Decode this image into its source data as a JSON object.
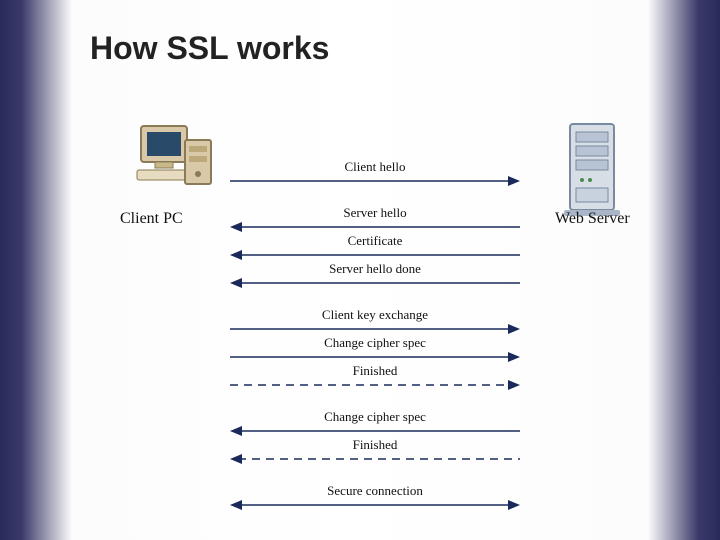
{
  "title": "How SSL works",
  "client_label": "Client PC",
  "server_label": "Web Server",
  "messages": {
    "m1": "Client hello",
    "m2": "Server hello",
    "m3": "Certificate",
    "m4": "Server hello done",
    "m5": "Client key exchange",
    "m6": "Change cipher spec",
    "m7": "Finished",
    "m8": "Change cipher spec",
    "m9": "Finished",
    "m10": "Secure connection"
  }
}
